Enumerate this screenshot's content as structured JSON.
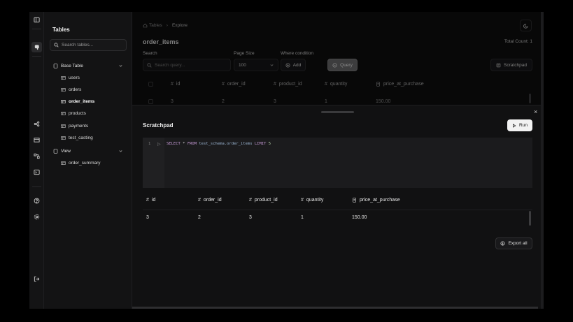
{
  "sidebar": {
    "title": "Tables",
    "search_placeholder": "Search tables...",
    "groups": [
      {
        "label": "Base Table",
        "items": [
          "users",
          "orders",
          "order_items",
          "products",
          "payments",
          "test_casting"
        ]
      },
      {
        "label": "View",
        "items": [
          "order_summary"
        ]
      }
    ],
    "active_item": "order_items"
  },
  "header": {
    "breadcrumb": [
      "Tables",
      "Explore"
    ],
    "page_title": "order_items",
    "total_count": "Total Count: 1"
  },
  "filters": {
    "search_label": "Search",
    "search_placeholder": "Search query...",
    "page_size_label": "Page Size",
    "page_size_value": "100",
    "where_label": "Where condition",
    "add_label": "Add",
    "query_label": "Query",
    "scratchpad_label": "Scratchpad"
  },
  "table": {
    "columns": [
      "id",
      "order_id",
      "product_id",
      "quantity",
      "price_at_purchase"
    ],
    "rows": [
      [
        "3",
        "2",
        "3",
        "1",
        "150.00"
      ]
    ]
  },
  "scratchpad": {
    "title": "Scratchpad",
    "run_label": "Run",
    "line_number": "1",
    "query": {
      "kw1": "SELECT",
      "star": " * ",
      "kw2": "FROM",
      "ident": " test_schema.order_items ",
      "kw3": "LIMIT",
      "limit": " 5"
    },
    "close_glyph": "×",
    "result_columns": [
      "id",
      "order_id",
      "product_id",
      "quantity",
      "price_at_purchase"
    ],
    "result_rows": [
      [
        "3",
        "2",
        "3",
        "1",
        "150.00"
      ]
    ],
    "export_label": "Export all"
  },
  "icons": {
    "rail": [
      "sidebar-toggle-icon",
      "elephant-logo-icon",
      "share-nodes-icon",
      "table-icon",
      "relations-icon",
      "terminal-icon",
      "help-icon",
      "settings-icon",
      "logout-icon"
    ],
    "hash_glyph": "#"
  },
  "colors": {
    "background": "#0e0e0f",
    "sidebar": "#131314",
    "run_button": "#f2f2f2"
  }
}
